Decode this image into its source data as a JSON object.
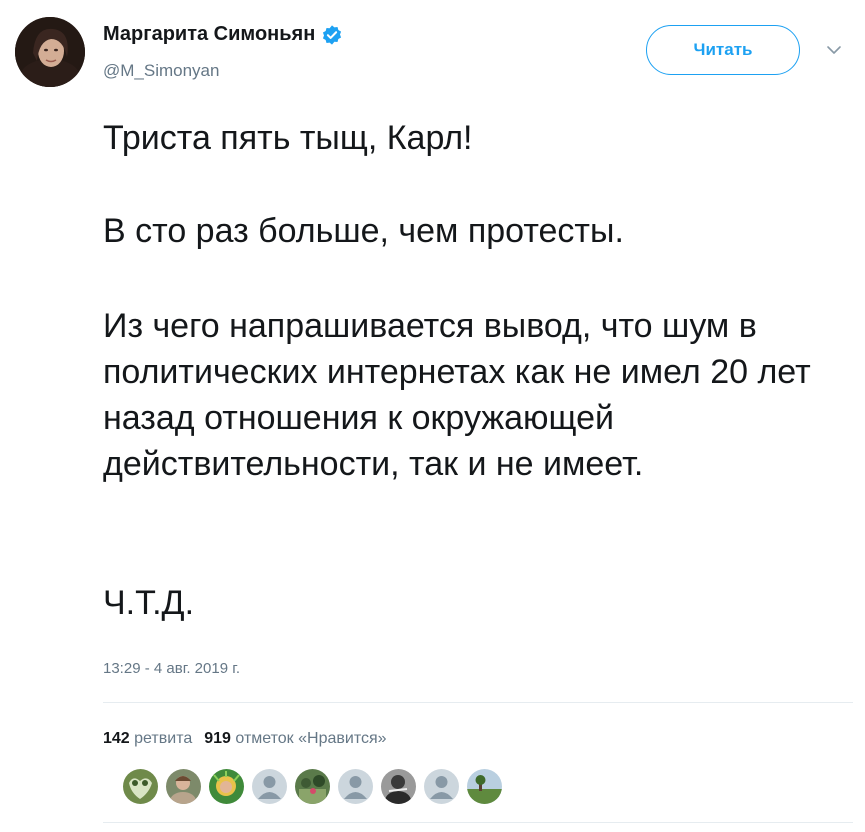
{
  "author": {
    "name": "Маргарита Симоньян",
    "handle": "@M_Simonyan",
    "verified": true
  },
  "follow_button": {
    "label": "Читать"
  },
  "tweet": {
    "paragraphs": [
      "Триста пять тыщ, Карл!",
      "В сто раз больше, чем протесты.",
      "Из чего напрашивается вывод, что шум в политических интернетах как не имел 20 лет назад отношения к окружающей действительности, так и не имеет.",
      "Ч.Т.Д."
    ],
    "timestamp": "13:29 - 4 авг. 2019 г."
  },
  "stats": {
    "retweets_count": "142",
    "retweets_label": "ретвита",
    "likes_count": "919",
    "likes_label": "отметок «Нравится»"
  },
  "liker_avatars": [
    {
      "icon": "photo-avatar"
    },
    {
      "icon": "photo-avatar"
    },
    {
      "icon": "photo-avatar"
    },
    {
      "icon": "default-avatar"
    },
    {
      "icon": "photo-avatar"
    },
    {
      "icon": "default-avatar"
    },
    {
      "icon": "photo-avatar"
    },
    {
      "icon": "default-avatar"
    },
    {
      "icon": "photo-avatar"
    }
  ],
  "colors": {
    "accent": "#1da1f2",
    "text": "#14171a",
    "muted": "#657786"
  }
}
